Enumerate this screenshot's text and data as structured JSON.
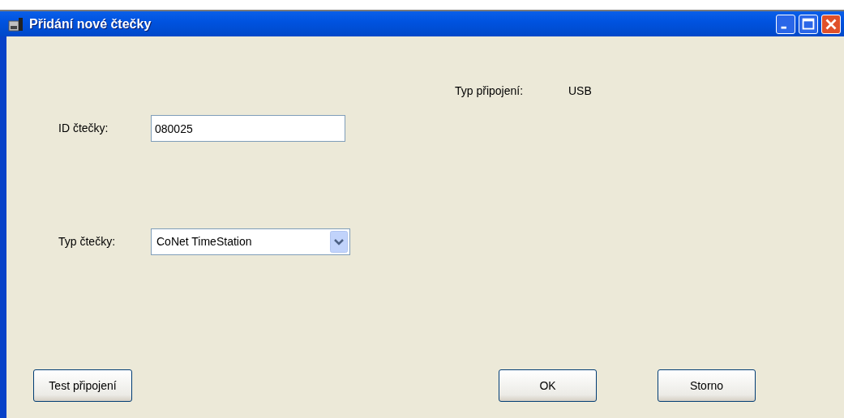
{
  "window": {
    "title": "Přidání nové čtečky"
  },
  "connection": {
    "label": "Typ připojení:",
    "value": "USB"
  },
  "reader_id": {
    "label": "ID čtečky:",
    "value": "080025"
  },
  "reader_type": {
    "label": "Typ čtečky:",
    "value": "CoNet TimeStation"
  },
  "buttons": [
    {
      "label": "Test připojení",
      "kind": "left"
    },
    {
      "label": "OK",
      "kind": "right"
    },
    {
      "label": "Storno",
      "kind": "right"
    }
  ]
}
